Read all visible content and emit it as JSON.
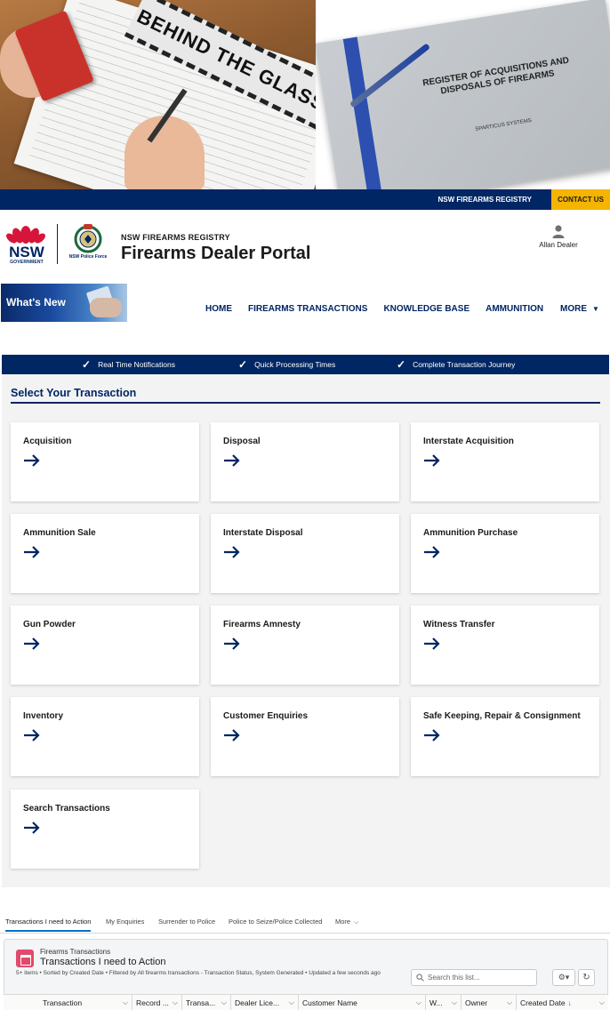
{
  "hero": {
    "left_headline": "BEHIND THE GLASS",
    "book_title": "REGISTER OF ACQUISITIONS AND DISPOSALS OF FIREARMS",
    "book_publisher": "SPARTICUS SYSTEMS"
  },
  "topbar": {
    "registry": "NSW FIREARMS REGISTRY",
    "contact": "CONTACT US"
  },
  "header": {
    "nsw_text": "NSW",
    "gov_text": "GOVERNMENT",
    "police_text": "NSW Police Force",
    "brand_small": "NSW FIREARMS REGISTRY",
    "brand_big": "Firearms Dealer Portal",
    "user_name": "Allan Dealer"
  },
  "nav": {
    "whats_new": "What's New",
    "links": [
      "HOME",
      "FIREARMS TRANSACTIONS",
      "KNOWLEDGE BASE",
      "AMMUNITION"
    ],
    "more": "MORE"
  },
  "benefits": [
    "Real Time Notifications",
    "Quick Processing Times",
    "Complete Transaction Journey"
  ],
  "transactions": {
    "title": "Select Your Transaction",
    "cards": [
      "Acquisition",
      "Disposal",
      "Interstate Acquisition",
      "Ammunition Sale",
      "Interstate Disposal",
      "Ammunition Purchase",
      "Gun Powder",
      "Firearms Amnesty",
      "Witness Transfer",
      "Inventory",
      "Customer Enquiries",
      "Safe Keeping, Repair & Consignment",
      "Search Transactions"
    ]
  },
  "tabs": [
    "Transactions I need to Action",
    "My Enquiries",
    "Surrender to Police",
    "Police to Seize/Police Collected",
    "More"
  ],
  "list": {
    "object": "Firearms Transactions",
    "title": "Transactions I need to Action",
    "meta": "5+ items • Sorted by Created Date • Filtered by All firearms transactions - Transaction Status, System Generated • Updated a few seconds ago",
    "search_placeholder": "Search this list...",
    "columns": [
      "Transaction",
      "Record ...",
      "Transa...",
      "Dealer Lice...",
      "Customer Name",
      "W...",
      "Owner",
      "Created Date"
    ]
  },
  "colors": {
    "navy": "#002664",
    "contact_yellow": "#f5b400",
    "nsw_red": "#d7153a",
    "panel_bg": "#f3f3f4"
  },
  "icons": [
    "waratah-icon",
    "police-badge-icon",
    "user-icon",
    "chevron-down-icon",
    "check-icon",
    "arrow-right-icon",
    "search-icon",
    "gear-icon",
    "refresh-icon",
    "list-icon"
  ]
}
